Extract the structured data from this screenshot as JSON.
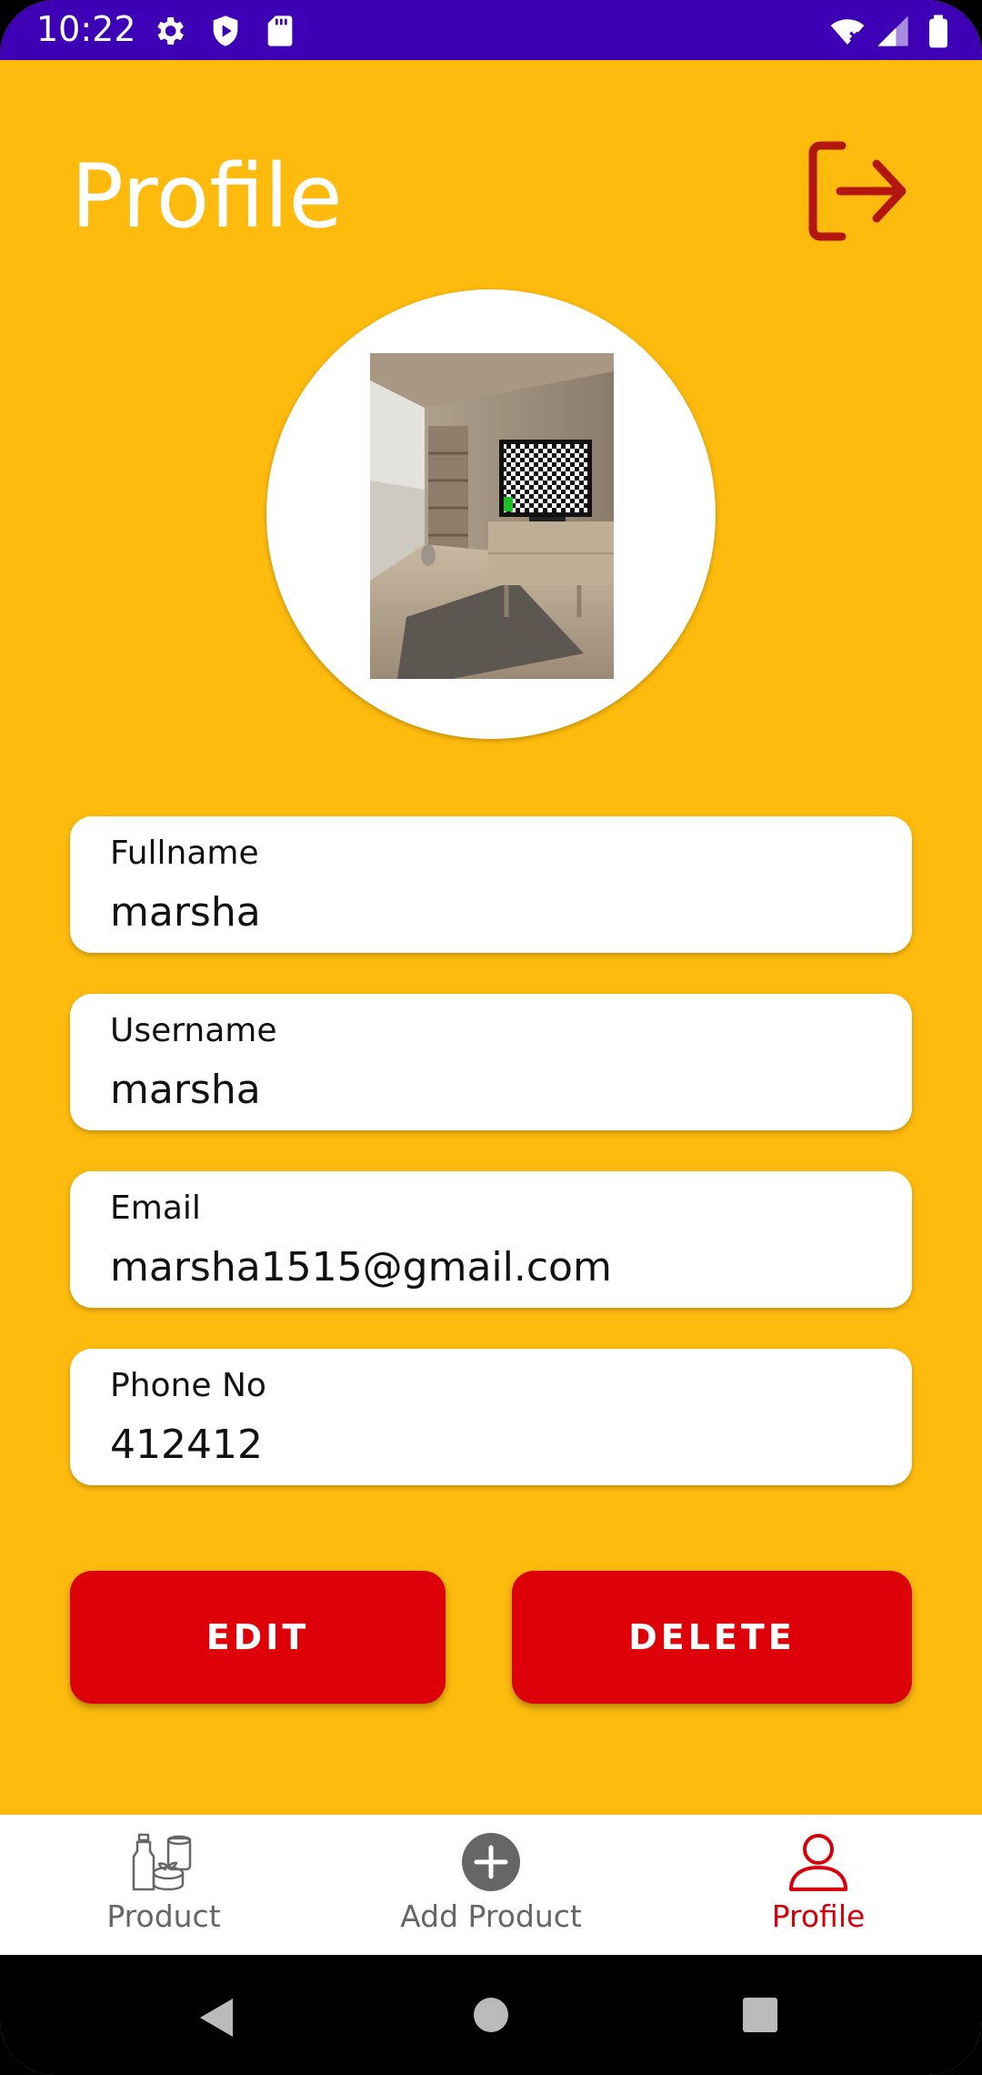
{
  "status_bar": {
    "time": "10:22",
    "icons": [
      "gear-icon",
      "shield-icon",
      "sd-card-icon",
      "wifi-icon",
      "signal-icon",
      "battery-icon"
    ]
  },
  "header": {
    "title": "Profile",
    "logout_icon": "logout-icon"
  },
  "profile": {
    "fields": [
      {
        "label": "Fullname",
        "value": "marsha"
      },
      {
        "label": "Username",
        "value": "marsha"
      },
      {
        "label": "Email",
        "value": "marsha1515@gmail.com"
      },
      {
        "label": "Phone No",
        "value": "412412"
      }
    ]
  },
  "actions": {
    "edit_label": "EDIT",
    "delete_label": "DELETE"
  },
  "bottom_nav": {
    "items": [
      {
        "label": "Product",
        "icon": "product-icon",
        "active": false
      },
      {
        "label": "Add Product",
        "icon": "add-circle-icon",
        "active": false
      },
      {
        "label": "Profile",
        "icon": "person-icon",
        "active": true
      }
    ]
  },
  "colors": {
    "background": "#FEBB0E",
    "status_bar": "#3D00B5",
    "accent": "#DD0009",
    "logout_icon": "#B3160E"
  }
}
